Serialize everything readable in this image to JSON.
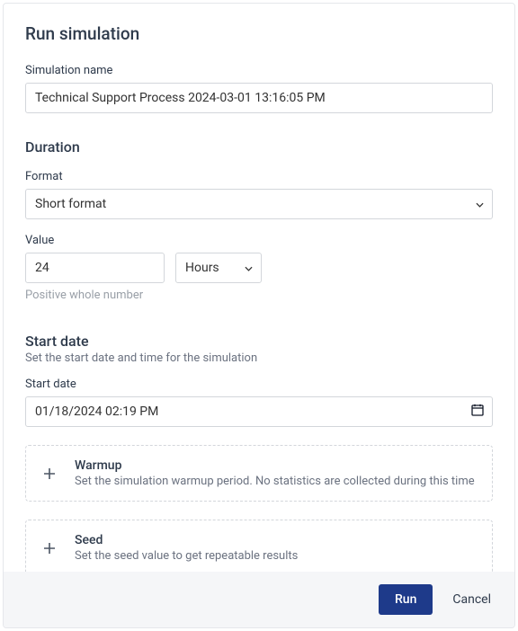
{
  "title": "Run simulation",
  "simName": {
    "label": "Simulation name",
    "value": "Technical Support Process 2024-03-01 13:16:05 PM"
  },
  "duration": {
    "title": "Duration",
    "format": {
      "label": "Format",
      "selected": "Short format"
    },
    "value": {
      "label": "Value",
      "value": "24",
      "helper": "Positive whole number"
    },
    "unit": {
      "selected": "Hours"
    }
  },
  "startDate": {
    "title": "Start date",
    "subtitle": "Set the start date and time for the simulation",
    "label": "Start date",
    "value": "01/18/2024 02:19 PM"
  },
  "warmup": {
    "title": "Warmup",
    "desc": "Set the simulation warmup period. No statistics are collected during this time"
  },
  "seed": {
    "title": "Seed",
    "desc": "Set the seed value to get repeatable results"
  },
  "footer": {
    "run": "Run",
    "cancel": "Cancel"
  }
}
